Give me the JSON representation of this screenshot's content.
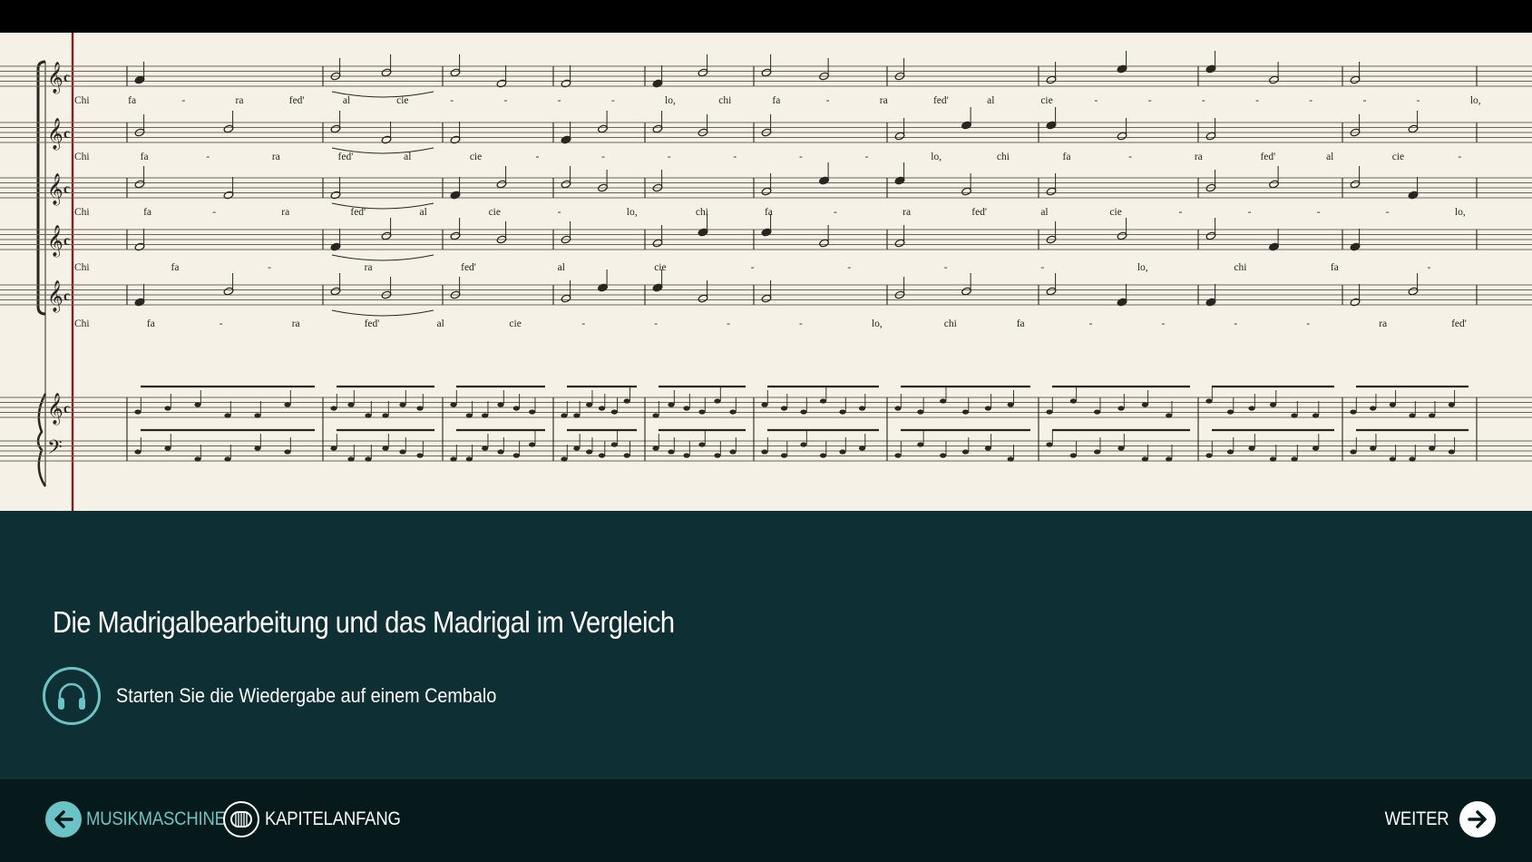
{
  "score": {
    "image_description_hidden": "",
    "staves": [
      {
        "syllables": [
          "Chi",
          "fa",
          "-",
          "ra",
          "fed'",
          "al",
          "cie",
          "-",
          "-",
          "-",
          "-",
          "lo,",
          "chi",
          "fa",
          "-",
          "ra",
          "fed'",
          "al",
          "cie",
          "-",
          "-",
          "-",
          "-",
          "-",
          "-",
          "-",
          "lo,"
        ]
      },
      {
        "syllables": [
          "Chi",
          "fa",
          "-",
          "ra",
          "fed'",
          "al",
          "cie",
          "-",
          "-",
          "-",
          "-",
          "-",
          "-",
          "lo,",
          "chi",
          "fa",
          "-",
          "ra",
          "fed'",
          "al",
          "cie",
          "-"
        ]
      },
      {
        "syllables": [
          "Chi",
          "fa",
          "-",
          "ra",
          "fed'",
          "al",
          "cie",
          "-",
          "lo,",
          "chi",
          "fa",
          "-",
          "ra",
          "fed'",
          "al",
          "cie",
          "-",
          "-",
          "-",
          "-",
          "lo,"
        ]
      },
      {
        "syllables": [
          "Chi",
          "fa",
          "-",
          "ra",
          "fed'",
          "al",
          "cie",
          "-",
          "-",
          "-",
          "-",
          "lo,",
          "chi",
          "fa",
          "-"
        ]
      },
      {
        "syllables": [
          "Chi",
          "fa",
          "-",
          "ra",
          "fed'",
          "al",
          "cie",
          "-",
          "-",
          "-",
          "-",
          "lo,",
          "chi",
          "fa",
          "-",
          "-",
          "-",
          "-",
          "ra",
          "fed'"
        ]
      }
    ]
  },
  "panel": {
    "title": "Die Madrigalbearbeitung und das Madrigal im Vergleich",
    "audio_text": "Starten Sie die Wiedergabe auf einem Cembalo",
    "audio_icon": "headphones-icon"
  },
  "nav": {
    "back_label": "MUSIKMASCHINE",
    "chapter_label": "KAPITELANFANG",
    "next_label": "WEITER"
  },
  "colors": {
    "accent": "#6cc3c6",
    "panel_bg": "#0e3034",
    "nav_bg": "#071a1b",
    "paper": "#f6f1e6"
  }
}
